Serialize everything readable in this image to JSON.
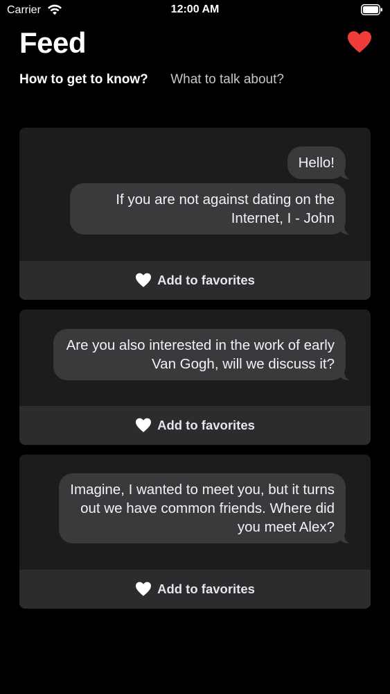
{
  "status_bar": {
    "carrier": "Carrier",
    "time": "12:00 AM",
    "icons": [
      "wifi-icon",
      "battery-icon"
    ]
  },
  "header": {
    "title": "Feed",
    "favorites_icon": "heart-icon",
    "heart_color": "#f03b3b"
  },
  "tabs": [
    {
      "label": "How to get to know?",
      "active": true
    },
    {
      "label": "What to talk about?",
      "active": false
    }
  ],
  "cards": [
    {
      "messages": [
        "Hello!",
        "If you are not against dating on the Internet, I - John"
      ],
      "favorite_label": "Add to favorites"
    },
    {
      "messages": [
        "Are you also interested in the work of early Van Gogh, will we discuss it?"
      ],
      "favorite_label": "Add to favorites"
    },
    {
      "messages": [
        "Imagine, I wanted to meet you, but it turns out we have common friends. Where did you meet Alex?"
      ],
      "favorite_label": "Add to favorites"
    }
  ],
  "colors": {
    "background": "#000000",
    "card": "#1c1c1e",
    "bubble": "#3a3a3c",
    "favorite_bar": "#2c2c2e"
  }
}
